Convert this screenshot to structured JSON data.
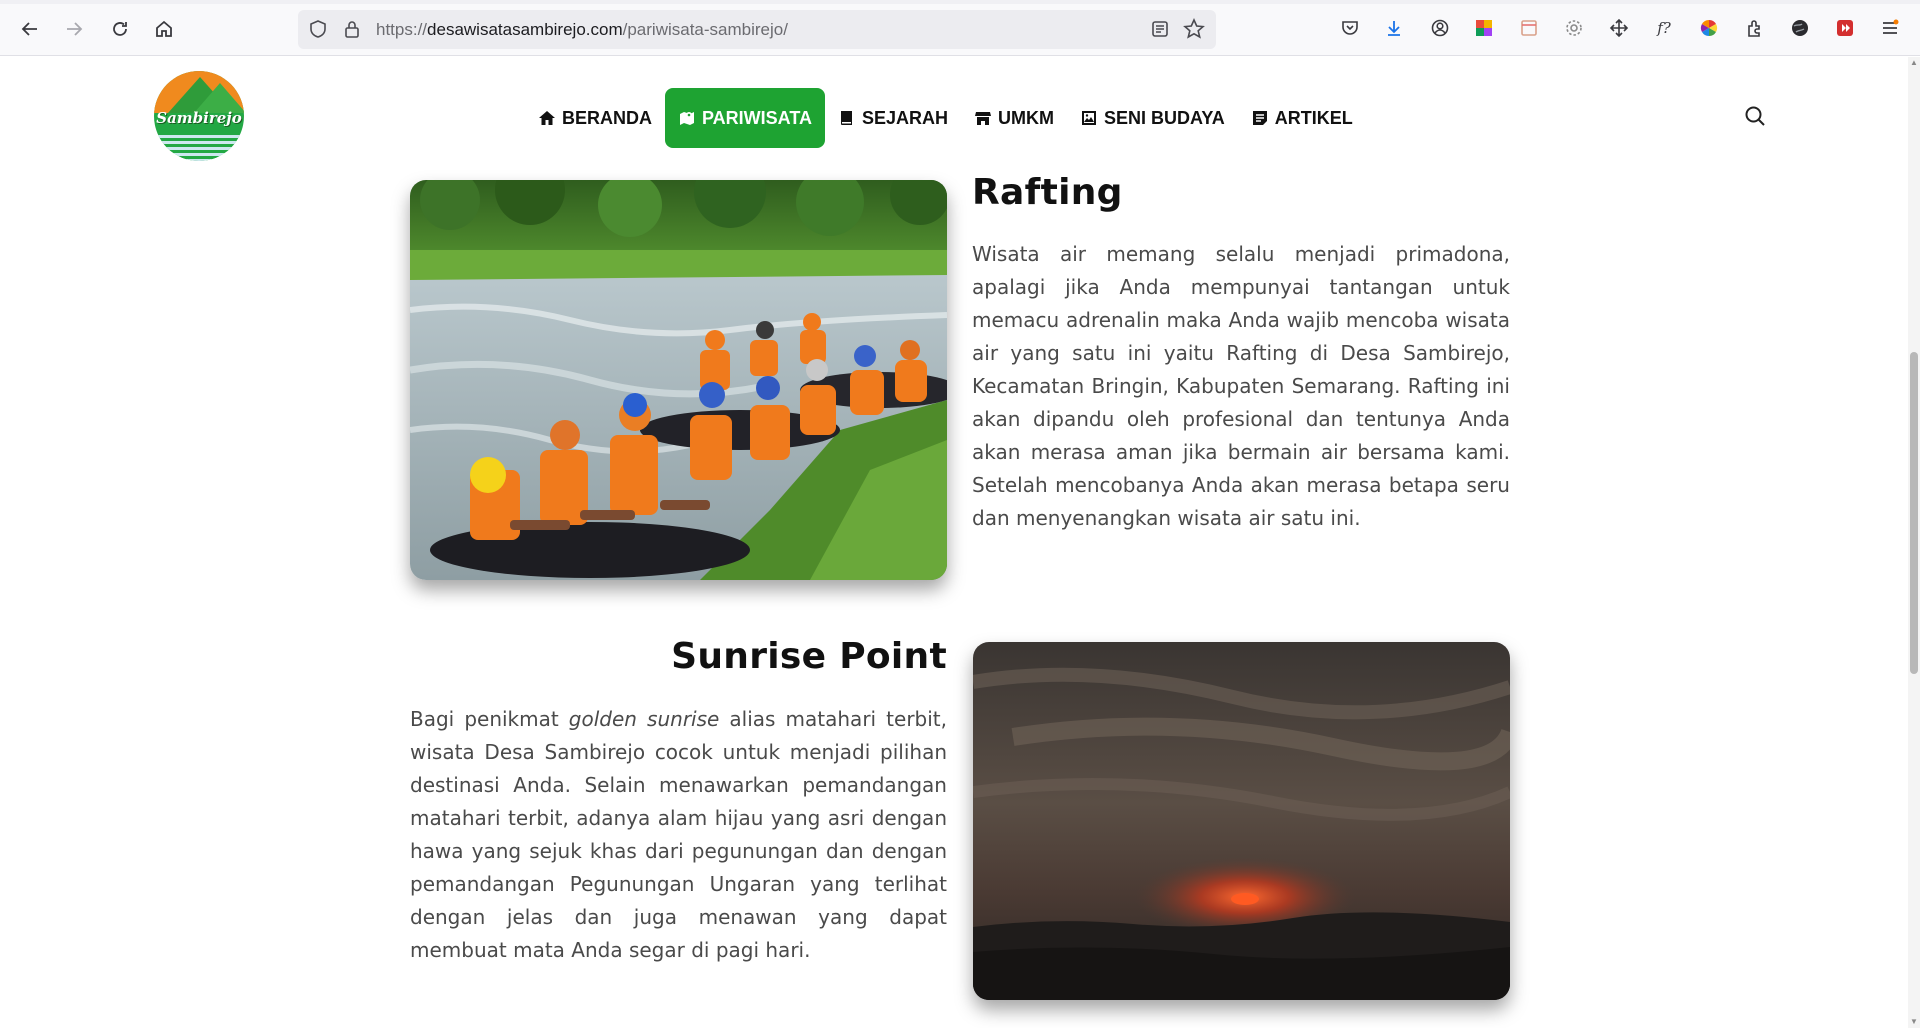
{
  "browser": {
    "url_prefix": "https://",
    "url_domain": "desawisatasambirejo.com",
    "url_path": "/pariwisata-sambirejo/"
  },
  "site": {
    "logo_text": "Sambirejo",
    "nav": [
      {
        "label": "BERANDA",
        "icon": "home-icon",
        "active": false
      },
      {
        "label": "PARIWISATA",
        "icon": "map-icon",
        "active": true
      },
      {
        "label": "SEJARAH",
        "icon": "book-icon",
        "active": false
      },
      {
        "label": "UMKM",
        "icon": "store-icon",
        "active": false
      },
      {
        "label": "SENI BUDAYA",
        "icon": "image-icon",
        "active": false
      },
      {
        "label": "ARTIKEL",
        "icon": "article-icon",
        "active": false
      }
    ],
    "accent_color": "#1ea332"
  },
  "sections": {
    "rafting": {
      "title": "Rafting",
      "body": "Wisata air memang selalu menjadi primadona, apalagi jika Anda mempunyai tantangan untuk memacu adrenalin maka Anda wajib mencoba wisata air yang satu ini yaitu Rafting di Desa Sambirejo, Kecamatan Bringin, Kabupaten Semarang. Rafting ini akan dipandu oleh profesional dan tentunya Anda akan merasa aman jika bermain air bersama kami. Setelah mencobanya Anda akan merasa betapa seru dan menyenangkan wisata air satu ini."
    },
    "sunrise": {
      "title": "Sunrise Point",
      "body_before": "Bagi penikmat ",
      "body_emphasis": "golden sunrise",
      "body_after": " alias matahari terbit, wisata Desa Sambirejo cocok untuk menjadi pilihan destinasi Anda. Selain menawarkan pemandangan matahari terbit, adanya alam hijau yang asri dengan hawa yang sejuk khas dari pegunungan dan dengan pemandangan Pegunungan Ungaran yang terlihat dengan jelas dan juga menawan yang dapat membuat mata Anda segar di pagi hari."
    }
  }
}
